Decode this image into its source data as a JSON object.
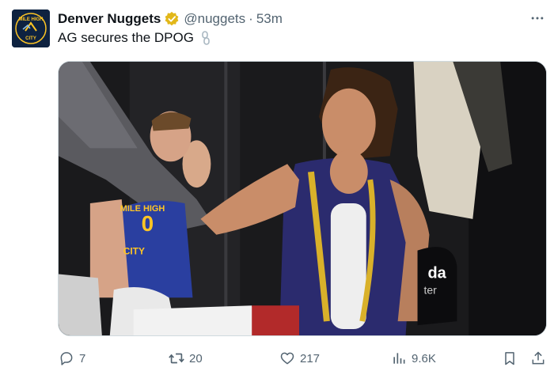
{
  "tweet": {
    "author_name": "Denver Nuggets",
    "handle": "@nuggets",
    "separator": "·",
    "time": "53m",
    "text": "AG secures the DPOG",
    "avatar_text_top": "MILE HIGH",
    "avatar_text_bottom": "CITY",
    "jersey_text": "MILE HIGH",
    "jersey_number": "0",
    "jersey_city": "CITY",
    "background_sign": "da",
    "background_sign_sub": "ter"
  },
  "actions": {
    "replies": "7",
    "reposts": "20",
    "likes": "217",
    "views": "9.6K"
  },
  "colors": {
    "accent": "#1d9bf0",
    "verified_gold": "#e2b719",
    "muted": "#536471",
    "nuggets_navy": "#0e2240",
    "nuggets_gold": "#fec524"
  },
  "icons": {
    "more": "more-horizontal-icon",
    "verified": "verified-badge-icon",
    "link": "link-chain-icon",
    "reply": "reply-icon",
    "repost": "repost-icon",
    "like": "heart-icon",
    "views": "views-chart-icon",
    "bookmark": "bookmark-icon",
    "share": "share-icon"
  }
}
